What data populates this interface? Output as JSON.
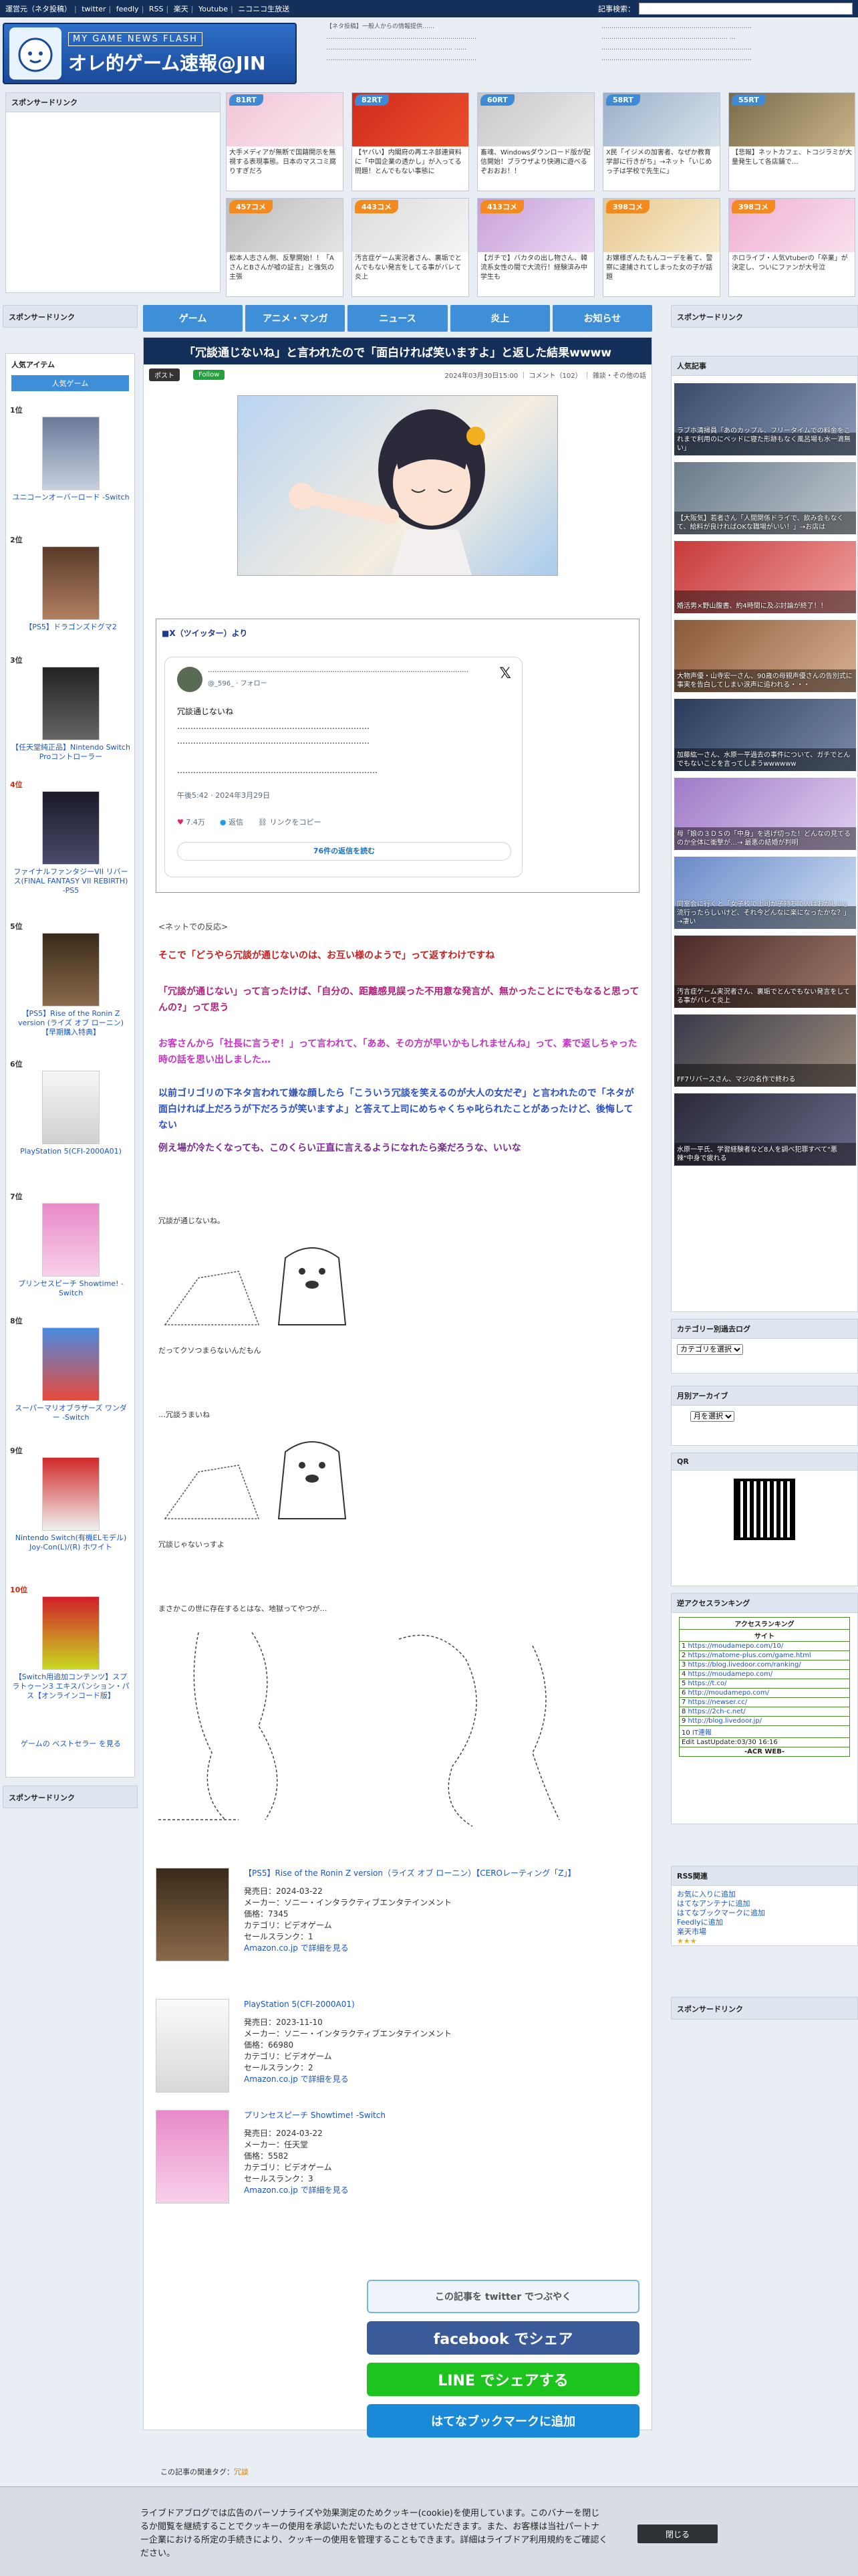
{
  "topbar": {
    "links": [
      "運営元（ネタ投稿）",
      "twitter",
      "feedly",
      "RSS",
      "楽天",
      "Youtube",
      "ニコニコ生放送"
    ],
    "search_label": "記事検索：",
    "search_placeholder": ""
  },
  "header": {
    "sub": "MY GAME NEWS FLASH",
    "main": "オレ的ゲーム速報@JIN",
    "news_a": [
      "【ネタ投稿】一般人からの情報提供……",
      "…………………………………………………………………",
      "……………………………………………………… ……",
      "…………………………………………………………………"
    ],
    "news_b": [
      "…………………………………………………………………",
      "……………………………………………………… …",
      "…………………………………………………………………",
      "…………………………………………………………………"
    ]
  },
  "sponsor": {
    "top_label": "スポンサードリンク",
    "left_label": "スポンサードリンク",
    "right_label": "スポンサードリンク",
    "left_bottom_label": "スポンサードリンク",
    "right_bottom_label": "スポンサードリンク"
  },
  "thumbs_row1": [
    {
      "badge": "81RT",
      "caption": "大手メディアが無断で国籍開示を無視する表現事態。日本のマスコミ腐りすぎだろ",
      "color": "#3e8ad6"
    },
    {
      "badge": "82RT",
      "caption": "【ヤバい】内閣府の再エネ部連資料に「中国企業の透かし」が入ってる問題！とんでもない事態に",
      "color": "#3e8ad6"
    },
    {
      "badge": "60RT",
      "caption": "畜魂、Windowsダウンロード版が配信開始！ブラウザより快適に遊べるぞおおお！！",
      "color": "#3e8ad6"
    },
    {
      "badge": "58RT",
      "caption": "X民「イジメの加害者、なぜか教育学部に行きがち」→ネット「いじめっ子は学校で先生に」",
      "color": "#3e8ad6"
    },
    {
      "badge": "55RT",
      "caption": "【悲報】ネットカフェ、トコジラミが大量発生して各店舗で…",
      "color": "#3e8ad6"
    }
  ],
  "thumbs_row2": [
    {
      "badge": "457コメ",
      "caption": "松本人志さん側、反撃開始！！「AさんとBさんが嘘の証言」と強気の主張",
      "color": "#f28a1e"
    },
    {
      "badge": "443コメ",
      "caption": "汚言症ゲーム実況者さん、裏垢でとんでもない発言をしてる事がバレて炎上",
      "color": "#f28a1e"
    },
    {
      "badge": "413コメ",
      "caption": "【ガチで】バカタの出し物さん、韓流系女性の間で大流行！経験済み中学生も",
      "color": "#f28a1e"
    },
    {
      "badge": "398コメ",
      "caption": "お嬢様ぎんたもんコーデを着て、警察に逮捕されてしまった女の子が話題",
      "color": "#f28a1e"
    },
    {
      "badge": "398コメ",
      "caption": "ホロライブ・人気Vtuberの「卒業」が決定し、ついにファンが大号泣",
      "color": "#f28a1e"
    }
  ],
  "nav": [
    "ゲーム",
    "アニメ・マンガ",
    "ニュース",
    "炎上",
    "お知らせ"
  ],
  "left": {
    "popular_label": "人気アイテム",
    "tab": "人気ゲーム",
    "items": [
      {
        "rank": "1位",
        "title": "ユニコーンオーバーロード -Switch",
        "color": "#6a7a9a"
      },
      {
        "rank": "2位",
        "title": "【PS5】ドラゴンズドグマ2",
        "color": "#5a3a2a"
      },
      {
        "rank": "3位",
        "title": "【任天堂純正品】Nintendo Switch Proコントローラー",
        "color": "#222"
      },
      {
        "rank": "4位",
        "title": "ファイナルファンタジーVII リバース(FINAL FANTASY VII REBIRTH) -PS5",
        "color": "#1a1a2a"
      },
      {
        "rank": "5位",
        "title": "【PS5】Rise of the Ronin Z version (ライズ オブ ローニン)【早期購入特典】",
        "color": "#3a2a1a"
      },
      {
        "rank": "6位",
        "title": "PlayStation 5(CFI-2000A01)",
        "color": "#f0f0f0"
      },
      {
        "rank": "7位",
        "title": "プリンセスピーチ Showtime! -Switch",
        "color": "#e88ac8"
      },
      {
        "rank": "8位",
        "title": "スーパーマリオブラザーズ ワンダー -Switch",
        "color": "#4a8ae0"
      },
      {
        "rank": "9位",
        "title": "Nintendo Switch(有機ELモデル) Joy-Con(L)/(R) ホワイト",
        "color": "#d02a2a"
      },
      {
        "rank": "10位",
        "title": "【Switch用追加コンテンツ】スプラトゥーン3 エキスパンション・パス【オンラインコード版】",
        "color": "#c8d820"
      }
    ],
    "more": "ゲームの ベストセラー を見る"
  },
  "article": {
    "title": "「冗談通じないね」と言われたので「面白ければ笑いますよ」と返した結果wwww",
    "tweet_btn": "ポスト",
    "follow_btn": "Follow",
    "meta": "2024年03月30日15:00 ｜ コメント（102） ｜ 雑談・その他の話",
    "source_label": "■X（ツイッター）より",
    "tweet": {
      "name": "………………………………………………………………………………………………………",
      "handle": "@_596_ · フォロー",
      "lines": [
        "冗談通じないね",
        "………………………………………………………………",
        "………………………………………………………………",
        "",
        "…………………………………………………………………"
      ],
      "time": "午後5:42 · 2024年3月29日",
      "likes": "7.4万",
      "replies": "返信",
      "copy": "リンクをコピー",
      "more": "76件の返信を読む"
    },
    "net_label": "<ネットでの反応>",
    "comments": [
      {
        "text": "そこで「どうやら冗談が通じないのは、お互い様のようで」って返すわけですね",
        "color": "#c81e1e"
      },
      {
        "text": "「冗談が通じない」って言ったけば、「自分の、距離感見誤った不用意な発言が、無かったことにでもなると思ってんの?」って思う",
        "color": "#b0207a"
      },
      {
        "text": "お客さんから「社長に言うぞ！」って言われて、「ああ、その方が早いかもしれませんね」って、素で返しちゃった時の話を思い出しました…",
        "color": "#c236c2"
      },
      {
        "text": "以前ゴリゴリの下ネタ言われて嫌な顔したら「こういう冗談を笑えるのが大人の女だぞ」と言われたので「ネタが面白ければ上だろうが下だろうが笑いますよ」と答えて上司にめちゃくちゃ叱られたことがあったけど、後悔してない",
        "color": "#2a50c8"
      },
      {
        "text": "例え場が冷たくなっても、このくらい正直に言えるようになれたら楽だろうな、いいな",
        "color": "#7a2a90"
      }
    ],
    "aa_labels": [
      "冗談が通じないね。",
      "だってクソつまらないんだもん",
      "…冗談うまいね",
      "冗談じゃないっすよ",
      "まさかこの世に存在するとはな、地獄ってやつが…"
    ],
    "products": [
      {
        "title": "【PS5】Rise of the Ronin Z version（ライズ オブ ローニン）【CEROレーティング「Z」】",
        "release": "発売日：2024-03-22",
        "maker": "メーカー：ソニー・インタラクティブエンタテインメント",
        "price": "価格：7345",
        "category": "カテゴリ：ビデオゲーム",
        "rank": "セールスランク：1",
        "link": "Amazon.co.jp で詳細を見る"
      },
      {
        "title": "PlayStation 5(CFI-2000A01)",
        "release": "発売日：2023-11-10",
        "maker": "メーカー：ソニー・インタラクティブエンタテインメント",
        "price": "価格：66980",
        "category": "カテゴリ：ビデオゲーム",
        "rank": "セールスランク：2",
        "link": "Amazon.co.jp で詳細を見る"
      },
      {
        "title": "プリンセスピーチ Showtime! -Switch",
        "release": "発売日：2024-03-22",
        "maker": "メーカー：任天堂",
        "price": "価格：5582",
        "category": "カテゴリ：ビデオゲーム",
        "rank": "セールスランク：3",
        "link": "Amazon.co.jp で詳細を見る"
      }
    ],
    "share": {
      "twitter": "この記事を twitter でつぶやく",
      "facebook": "facebook でシェア",
      "line": "LINE でシェアする",
      "hatena": "はてなブックマークに追加"
    },
    "related_label": "この記事の関連タグ：",
    "related_tag": "冗談"
  },
  "right": {
    "popular_label": "人気記事",
    "popular": [
      "ラブホ清掃員「あのカップル、フリータイムでの料金をこれまで利用のにベッドに寝た形跡もなく風呂場も水一滴無い」",
      "【大阪気】若者さん「人間関係ドライで、飲み会もなくて、給料が良ければOKな職場がいい！」→お店は",
      "婚活男×野山腹書、約4時間に及ぶ討論が終了！！",
      "大物声優・山寺宏一さん、90歳の母親声優さんの告別式に事実を告白してしまい涙声に追われる・・・",
      "加藤紘一さん、水原一平過去の事件について、ガチでとんでもないことを言ってしまうwwwwww",
      "母「娘の３ＤＳの「中身」を逃げ切った！どんなの見てるのか全体に衝撃が…→ 最悪の結婚が判明",
      "同室会に行くと「女子校で上司が子持ちで人はおかしい」流行ったらしいけど、それ今どんなに楽になったかな？」→凄い",
      "汚言症ゲーム実況者さん、裏垢でとんでもない発言をしてる事がバレて炎上",
      "FF7リバースさん、マジの名作で終わる",
      "水原一平氏、学習経験者など8人を調べ犯罪すべて\"悪辣\"中身で疲れる"
    ],
    "category_label": "カテゴリー別過去ログ",
    "category_select": "カテゴリを選択",
    "archive_label": "月別アーカイブ",
    "archive_select": "月を選択",
    "qr_label": "QR",
    "acr_label": "逆アクセスランキング",
    "acr_title": "アクセスランキング",
    "acr_sub": "サイト",
    "acr_rows": [
      "https://moudamepo.com/10/",
      "https://matome-plus.com/game.html",
      "https://blog.livedoor.com/ranking/",
      "https://moudamepo.com/",
      "https://t.co/",
      "http://moudamepo.com/",
      "https://newser.cc/",
      "https://2ch-c.net/",
      "http://blog.livedoor.jp/",
      "IT連報"
    ],
    "acr_foot": "Edit LastUpdate:03/30 16:16",
    "acr_brand": "-ACR WEB-",
    "rss_label": "RSS関連",
    "rss_links": [
      "お気に入りに追加",
      "はてなアンテナに追加",
      "はてなブックマークに追加",
      "Feedlyに追加",
      "楽天市場"
    ]
  },
  "cookie": {
    "text": "ライブドアブログでは広告のパーソナライズや効果測定のためクッキー(cookie)を使用しています。このバナーを閉じるか閲覧を継続することでクッキーの使用を承認いただいたものとさせていただきます。また、お客様は当社パートナー企業における所定の手続きにより、クッキーの使用を管理することもできます。詳細はライブドア利用規約をご確認ください。",
    "close": "閉じる"
  }
}
